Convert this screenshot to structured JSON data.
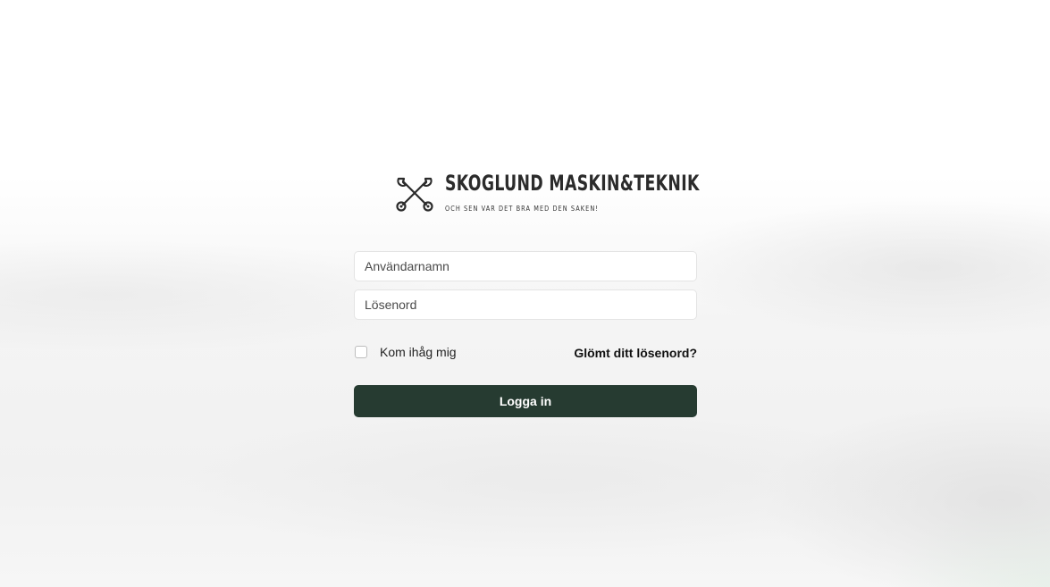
{
  "brand": {
    "name": "SKOGLUND MASKIN&TEKNIK",
    "tagline": "OCH SEN VAR DET BRA MED DEN SAKEN!",
    "icon": "crossed-wrenches-icon",
    "color": "#2b2b2b"
  },
  "login": {
    "username_placeholder": "Användarnamn",
    "username_value": "",
    "password_placeholder": "Lösenord",
    "password_value": "",
    "remember_label": "Kom ihåg mig",
    "remember_checked": false,
    "forgot_label": "Glömt ditt lösenord?",
    "submit_label": "Logga in",
    "accent_color": "#263b31"
  }
}
